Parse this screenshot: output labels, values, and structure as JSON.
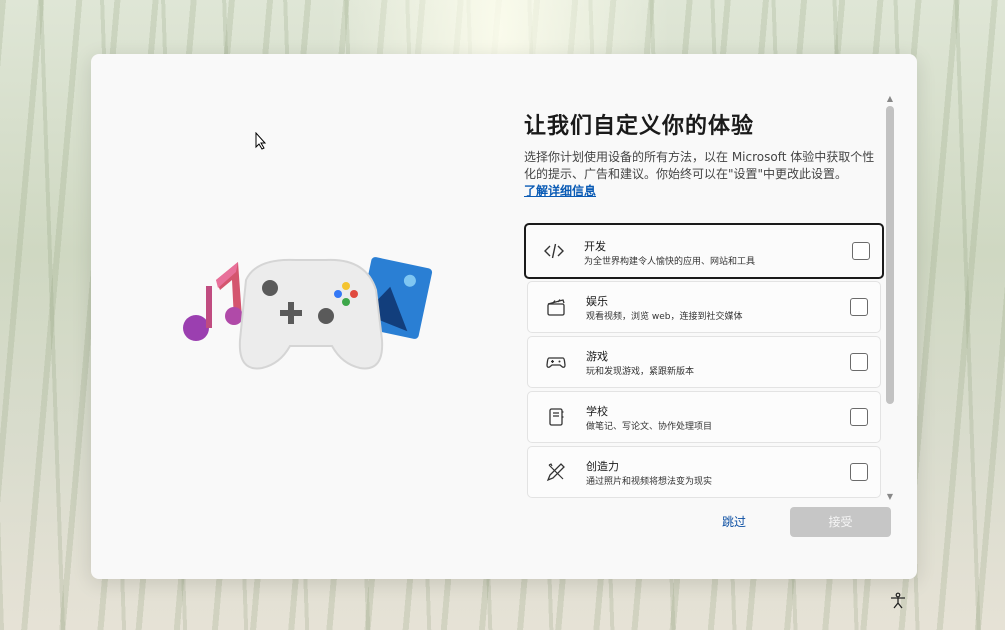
{
  "page": {
    "title": "让我们自定义你的体验",
    "description": "选择你计划使用设备的所有方法，以在 Microsoft 体验中获取个性化的提示、广告和建议。你始终可以在\"设置\"中更改此设置。",
    "learn_more": "了解详细信息"
  },
  "options": [
    {
      "title": "开发",
      "subtitle": "为全世界构建令人愉快的应用、网站和工具",
      "icon": "code-icon",
      "checked": false,
      "selected": true
    },
    {
      "title": "娱乐",
      "subtitle": "观看视频，浏览 web，连接到社交媒体",
      "icon": "clapperboard-icon",
      "checked": false
    },
    {
      "title": "游戏",
      "subtitle": "玩和发现游戏，紧跟新版本",
      "icon": "gamepad-icon",
      "checked": false
    },
    {
      "title": "学校",
      "subtitle": "做笔记、写论文、协作处理项目",
      "icon": "notebook-icon",
      "checked": false
    },
    {
      "title": "创造力",
      "subtitle": "通过照片和视频将想法变为现实",
      "icon": "pen-brush-icon",
      "checked": false
    }
  ],
  "buttons": {
    "skip": "跳过",
    "accept": "接受"
  },
  "colors": {
    "link": "#0a5bb5",
    "accept_disabled": "#c6c6c6"
  }
}
